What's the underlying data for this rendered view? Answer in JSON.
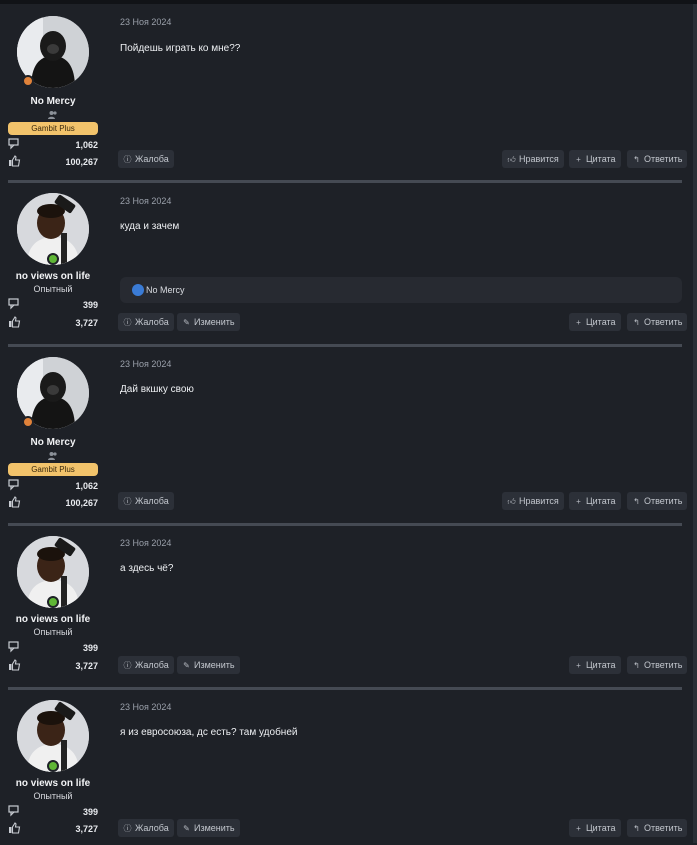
{
  "labels": {
    "report": "Жалоба",
    "edit": "Изменить",
    "like": "Нравится",
    "quote": "Цитата",
    "reply": "Ответить"
  },
  "icons": {
    "report": "report-icon",
    "edit": "pencil-icon",
    "like": "thumbs-up-icon",
    "quote": "plus-icon",
    "reply": "reply-arrow-icon",
    "messages": "chat-bubbles-icon",
    "reactions": "thumbs-up-icon"
  },
  "colors": {
    "background": "#1e2127",
    "separator": "#454a53",
    "badge": "#f2c36b",
    "online_dot": "#5fb636",
    "away_dot": "#e0823a",
    "reaction_blue": "#3a7bd5"
  },
  "posts": [
    {
      "username": "No Mercy",
      "badge": "Gambit Plus",
      "messages": "1,062",
      "reactions": "100,267",
      "date": "23 Ноя 2024",
      "text": "Пойдешь играть ко мне??"
    },
    {
      "username": "no views on life",
      "rank": "Опытный",
      "messages": "399",
      "reactions": "3,727",
      "date": "23 Ноя 2024",
      "text": "куда и зачем",
      "reacted_by": "No Mercy"
    },
    {
      "username": "No Mercy",
      "badge": "Gambit Plus",
      "messages": "1,062",
      "reactions": "100,267",
      "date": "23 Ноя 2024",
      "text": "Дай вкшку свою"
    },
    {
      "username": "no views on life",
      "rank": "Опытный",
      "messages": "399",
      "reactions": "3,727",
      "date": "23 Ноя 2024",
      "text": "а здесь чё?"
    },
    {
      "username": "no views on life",
      "rank": "Опытный",
      "messages": "399",
      "reactions": "3,727",
      "date": "23 Ноя 2024",
      "text": "я из евросоюза, дс есть? там удобней"
    }
  ]
}
